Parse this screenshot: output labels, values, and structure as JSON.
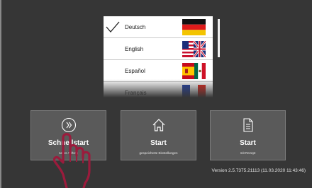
{
  "languages": {
    "items": [
      {
        "label": "Deutsch",
        "selected": true,
        "flag_icon": "germany-flag-icon"
      },
      {
        "label": "English",
        "selected": false,
        "flag_icon": "uk-flag-icon"
      },
      {
        "label": "Español",
        "selected": false,
        "flag_icon": "spain-flag-icon"
      },
      {
        "label": "Français",
        "selected": false,
        "flag_icon": "france-flag-icon"
      }
    ]
  },
  "tiles": [
    {
      "title": "Schnellstart",
      "subtitle": "neuer Auftrag",
      "icon": "double-chevron-right-icon"
    },
    {
      "title": "Start",
      "subtitle": "gespeicherte Einstellungen",
      "icon": "home-icon"
    },
    {
      "title": "Start",
      "subtitle": "mit Rezept",
      "icon": "document-icon"
    }
  ],
  "version": "Version 2.5.7375.21113 (11.03.2020 11:43:46)",
  "colors": {
    "background": "#363636",
    "tile": "#5a5a5a",
    "hand_outline": "#9b1b3c"
  }
}
